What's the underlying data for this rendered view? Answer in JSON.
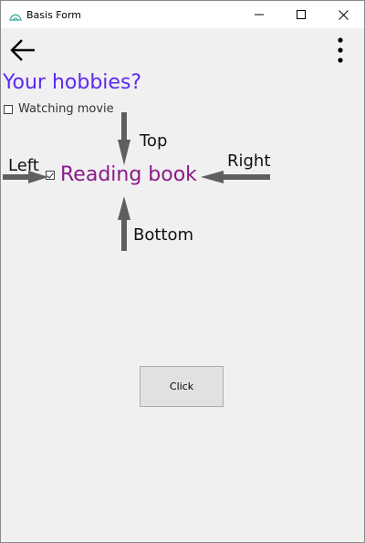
{
  "window": {
    "title": "Basis Form",
    "controls": {
      "minimize": "minimize-icon",
      "maximize": "maximize-icon",
      "close": "close-icon"
    }
  },
  "appbar": {
    "back_icon": "arrow-left-icon",
    "more_icon": "more-vertical-icon"
  },
  "form": {
    "heading": "Your hobbies?",
    "checkboxes": [
      {
        "label": "Watching movie",
        "checked": false
      },
      {
        "label": "Reading book",
        "checked": true
      }
    ],
    "button_label": "Click"
  },
  "annotations": {
    "top": "Top",
    "left": "Left",
    "right": "Right",
    "bottom": "Bottom"
  },
  "colors": {
    "heading": "#5b29f0",
    "checkbox_label_highlight": "#8b1a88",
    "arrow": "#5f5f5f",
    "background": "#f0f0f0"
  }
}
